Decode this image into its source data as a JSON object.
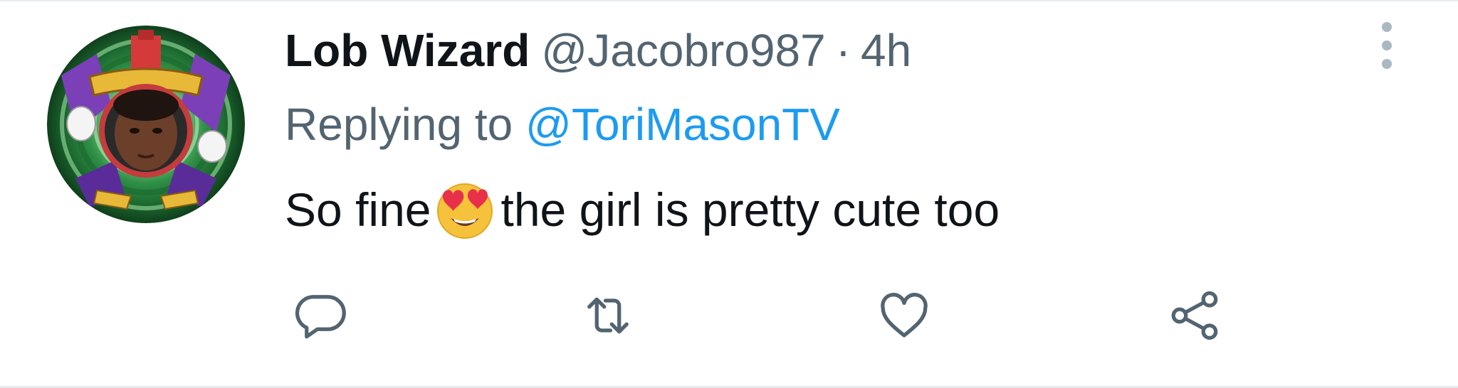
{
  "tweet": {
    "display_name": "Lob Wizard",
    "handle": "@Jacobro987",
    "separator": "·",
    "timestamp": "4h",
    "reply_prefix": "Replying to",
    "reply_to": "@ToriMasonTV",
    "text_before_emoji": "So fine",
    "emoji": "smiling-face-with-heart-eyes",
    "text_after_emoji": "the girl is pretty cute too"
  },
  "actions": [
    {
      "name": "reply",
      "icon": "comment-icon"
    },
    {
      "name": "retweet",
      "icon": "retweet-icon"
    },
    {
      "name": "like",
      "icon": "heart-icon"
    },
    {
      "name": "share",
      "icon": "share-icon"
    }
  ],
  "colors": {
    "text_primary": "#0f1419",
    "text_secondary": "#536471",
    "link": "#1d9bf0",
    "icon": "#536471",
    "divider": "#e6ecf0"
  }
}
